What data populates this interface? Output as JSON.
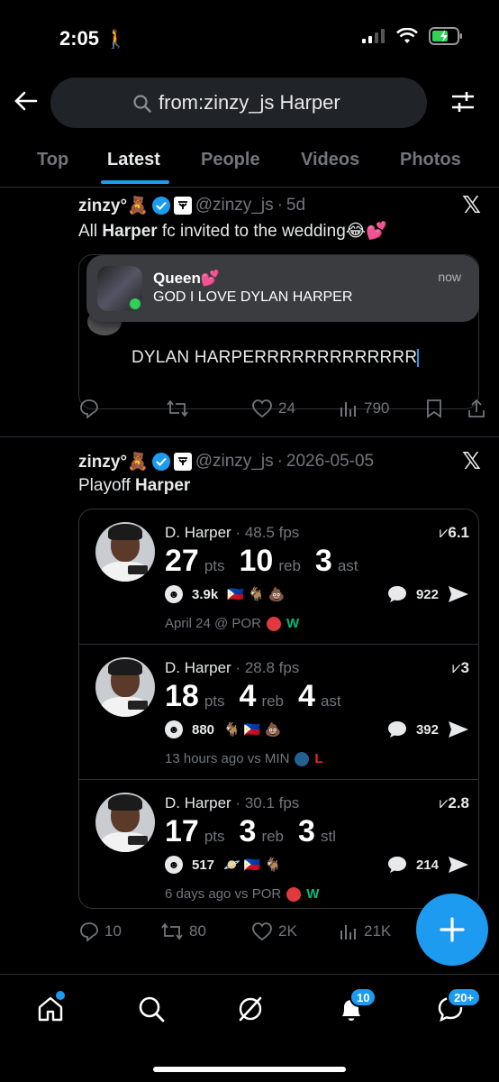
{
  "status": {
    "time": "2:05"
  },
  "search": {
    "query": "from:zinzy_js Harper"
  },
  "tabs": [
    {
      "label": "Top"
    },
    {
      "label": "Latest"
    },
    {
      "label": "People"
    },
    {
      "label": "Videos"
    },
    {
      "label": "Photos"
    }
  ],
  "tweet1": {
    "name": "zinzy°🧸",
    "handle": "@zinzy_js",
    "age": "5d",
    "text_pre": "All ",
    "text_bold": "Harper",
    "text_post": " fc invited to the wedding😂💕",
    "notification": {
      "title": "Queen💕",
      "body": "GOD I LOVE DYLAN HARPER",
      "time": "now"
    },
    "quote_text": "DYLAN HARPERRRRRRRRRRRRR",
    "actions": {
      "replies": "",
      "reposts": "",
      "likes": "24",
      "views": "790"
    }
  },
  "tweet2": {
    "name": "zinzy°🧸",
    "handle": "@zinzy_js",
    "date": "2026-05-05",
    "text_pre": "Playoff ",
    "text_bold": "Harper",
    "rows": [
      {
        "player": "D. Harper",
        "fps": "48.5 fps",
        "rating": "6.1",
        "s1": "27",
        "l1": "pts",
        "s2": "10",
        "l2": "reb",
        "s3": "3",
        "l3": "ast",
        "reacts": "3.9k",
        "emojis": "🇵🇭 🐐 💩",
        "comments": "922",
        "game": "April 24 @ POR",
        "team_color": "#e03a3e",
        "result": "W"
      },
      {
        "player": "D. Harper",
        "fps": "28.8 fps",
        "rating": "3",
        "s1": "18",
        "l1": "pts",
        "s2": "4",
        "l2": "reb",
        "s3": "4",
        "l3": "ast",
        "reacts": "880",
        "emojis": "🐐 🇵🇭 💩",
        "comments": "392",
        "game": "13 hours ago vs MIN",
        "team_color": "#236192",
        "result": "L"
      },
      {
        "player": "D. Harper",
        "fps": "30.1 fps",
        "rating": "2.8",
        "s1": "17",
        "l1": "pts",
        "s2": "3",
        "l2": "reb",
        "s3": "3",
        "l3": "stl",
        "reacts": "517",
        "emojis": "🪐 🇵🇭 🐐",
        "comments": "214",
        "game": "6 days ago vs POR",
        "team_color": "#e03a3e",
        "result": "W"
      }
    ],
    "actions": {
      "replies": "10",
      "reposts": "80",
      "likes": "2K",
      "views": "21K"
    }
  },
  "navbar": {
    "notif_badge": "10",
    "messages_badge": "20+"
  },
  "colors": {
    "accent": "#1d9bf0",
    "win": "#00ba7c",
    "loss": "#f4212e"
  }
}
